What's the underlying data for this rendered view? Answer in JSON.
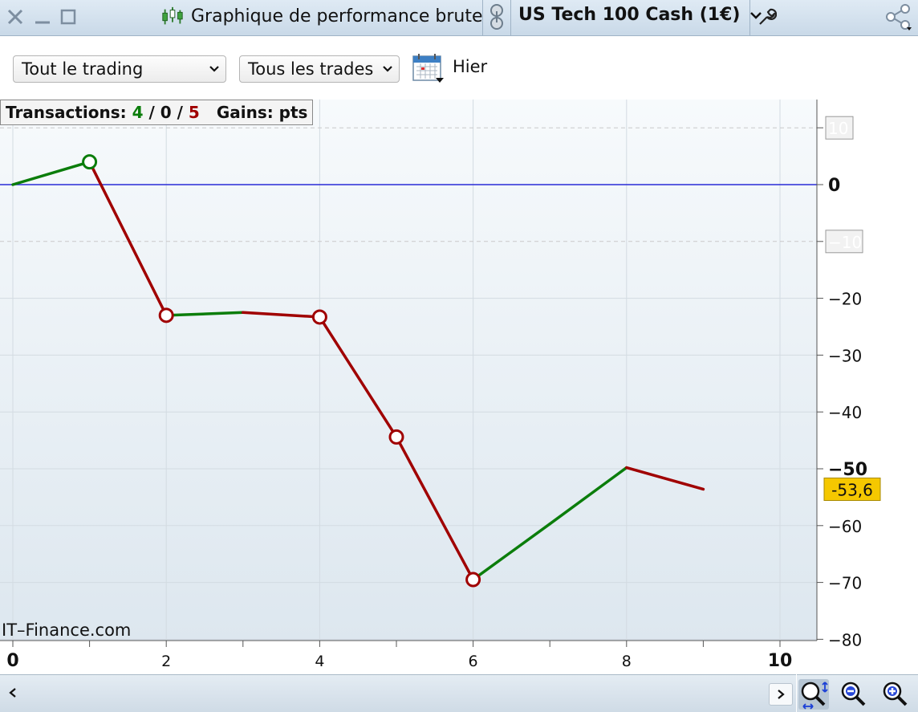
{
  "window": {
    "title": "Graphique de performance brute",
    "instrument": "US Tech 100 Cash (1€)"
  },
  "toolbar": {
    "scope_select": "Tout le trading",
    "trades_select": "Tous les trades",
    "date_label": "Hier"
  },
  "info": {
    "transactions_label": "Transactions:",
    "wins": "4",
    "sep1": "/",
    "neutral": "0",
    "sep2": "/",
    "losses": "5",
    "gains_label": "Gains: pts"
  },
  "watermark": "IT–Finance.com",
  "current_value_label": "-53,6",
  "colors": {
    "gain": "#0b7d0b",
    "loss": "#a00000",
    "zero_line": "#2b2bd6",
    "current_badge": "#f5c800"
  },
  "chart_data": {
    "type": "line",
    "title": "",
    "xlabel": "",
    "ylabel": "",
    "xlim": [
      0,
      10
    ],
    "ylim": [
      -80,
      10
    ],
    "x_ticks": [
      "0",
      "2",
      "4",
      "6",
      "8",
      "10"
    ],
    "y_ticks": [
      "10",
      "0",
      "-10",
      "-20",
      "-30",
      "-40",
      "-50",
      "-60",
      "-70",
      "-80"
    ],
    "grid": true,
    "zero_line": 0,
    "points": [
      {
        "x": 0,
        "y": 0,
        "result": "start"
      },
      {
        "x": 1,
        "y": 4,
        "result": "gain"
      },
      {
        "x": 2,
        "y": -23,
        "result": "loss"
      },
      {
        "x": 3,
        "y": -22.5,
        "result": "gain"
      },
      {
        "x": 4,
        "y": -23.3,
        "result": "loss"
      },
      {
        "x": 5,
        "y": -44.4,
        "result": "loss"
      },
      {
        "x": 6,
        "y": -69.5,
        "result": "loss"
      },
      {
        "x": 7,
        "y": -59.7,
        "result": "gain"
      },
      {
        "x": 8,
        "y": -49.8,
        "result": "gain"
      },
      {
        "x": 9,
        "y": -53.6,
        "result": "loss"
      }
    ],
    "marked_points": [
      1,
      2,
      4,
      5,
      6
    ],
    "current_value": -53.6
  }
}
